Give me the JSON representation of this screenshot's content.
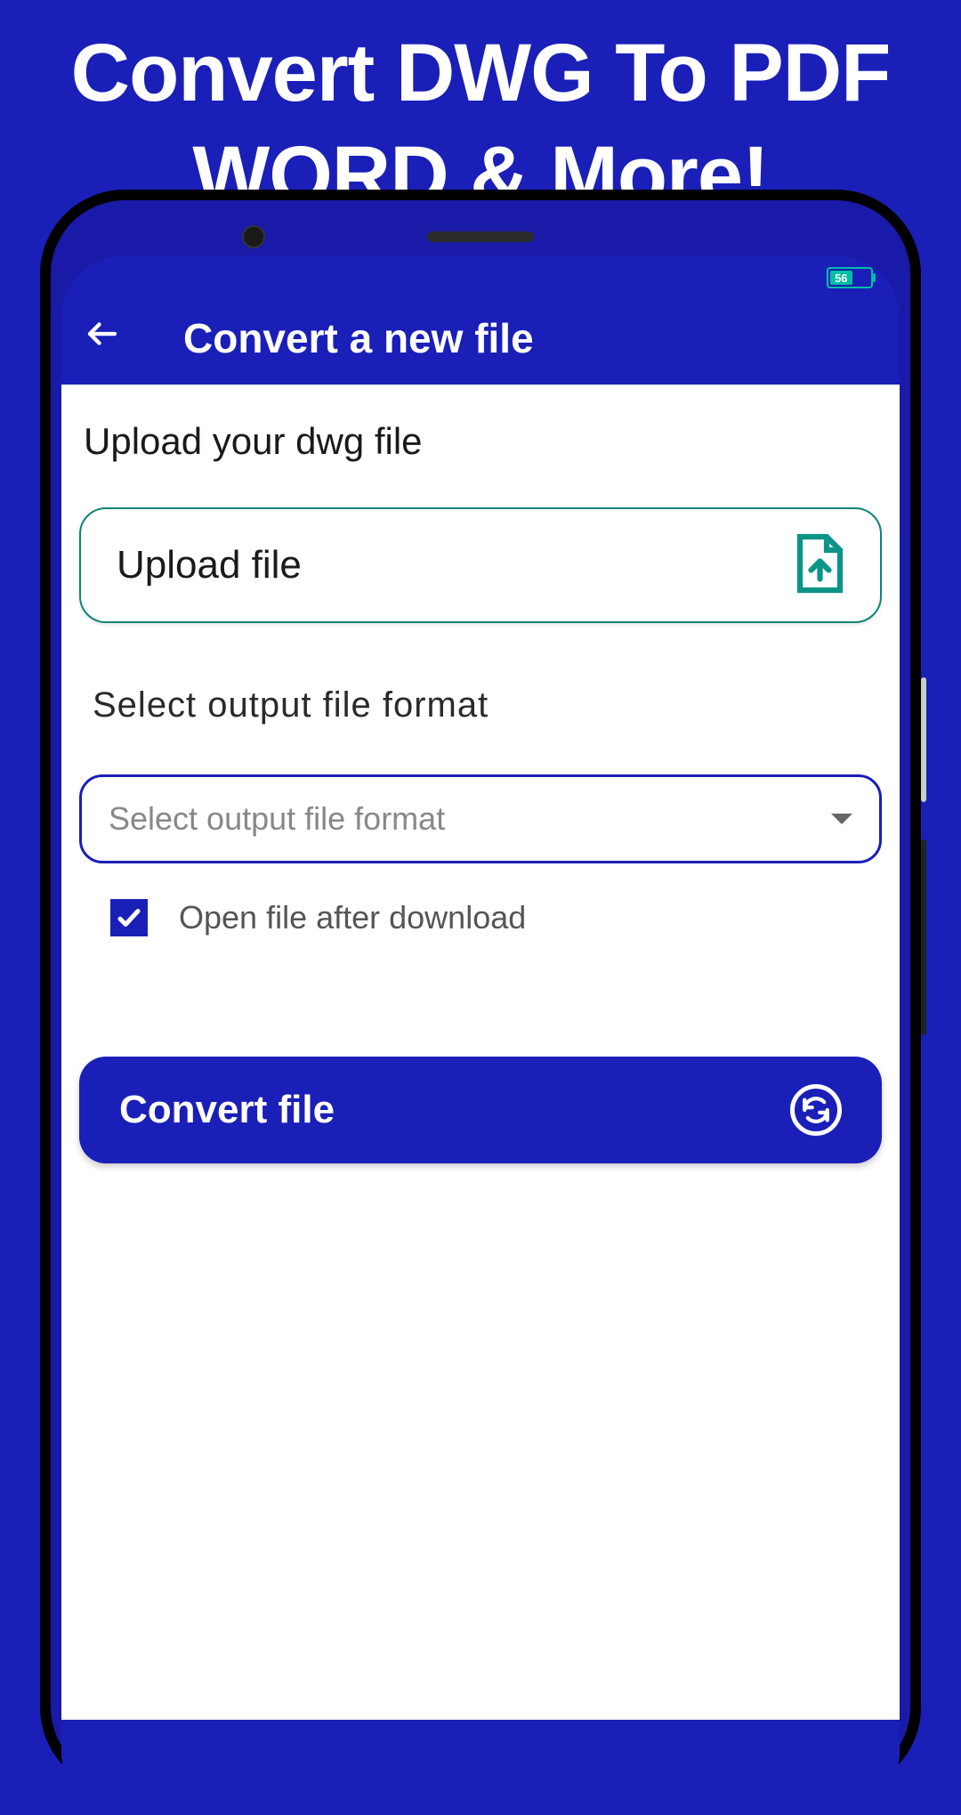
{
  "hero": {
    "title_line1": "Convert DWG To PDF",
    "title_line2": "WORD & More!"
  },
  "statusbar": {
    "battery_level": "56"
  },
  "header": {
    "title": "Convert a new file"
  },
  "upload": {
    "section_label": "Upload your dwg file",
    "button_label": "Upload file"
  },
  "format": {
    "label": "Select output file format",
    "placeholder": "Select output file format"
  },
  "checkbox": {
    "label": "Open file after download",
    "checked": true
  },
  "convert": {
    "label": "Convert file"
  }
}
